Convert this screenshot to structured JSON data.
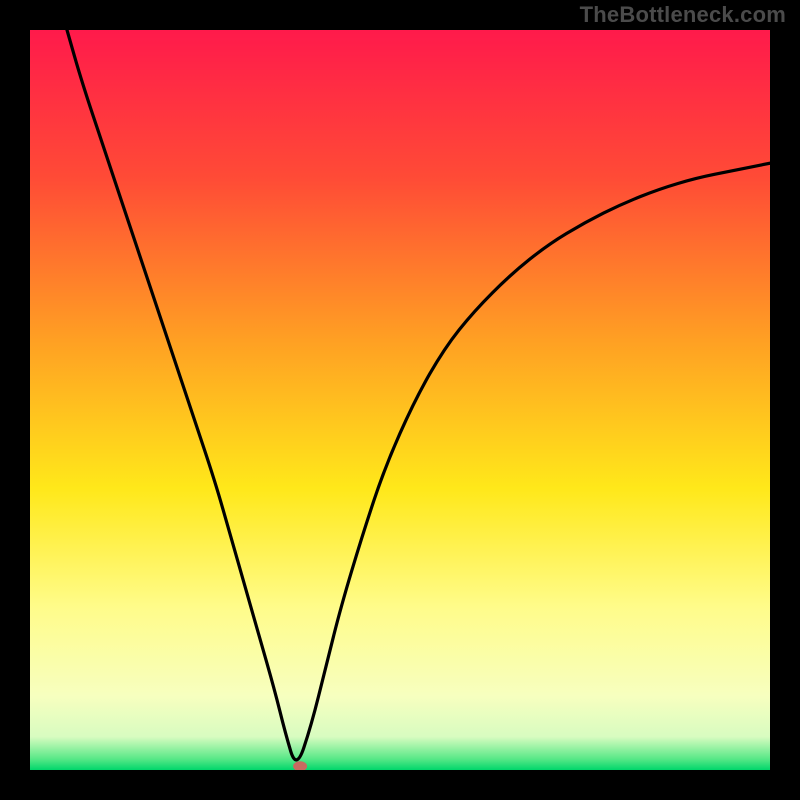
{
  "watermark": "TheBottleneck.com",
  "chart_data": {
    "type": "line",
    "title": "",
    "xlabel": "",
    "ylabel": "",
    "xlim": [
      0,
      100
    ],
    "ylim": [
      0,
      100
    ],
    "grid": false,
    "legend": false,
    "gradient_stops": [
      {
        "offset": 0.0,
        "color": "#ff1a4b"
      },
      {
        "offset": 0.2,
        "color": "#ff4b36"
      },
      {
        "offset": 0.42,
        "color": "#ffa023"
      },
      {
        "offset": 0.62,
        "color": "#ffe81a"
      },
      {
        "offset": 0.78,
        "color": "#fffc8a"
      },
      {
        "offset": 0.9,
        "color": "#f7ffbf"
      },
      {
        "offset": 0.955,
        "color": "#d8fcc0"
      },
      {
        "offset": 0.985,
        "color": "#58e887"
      },
      {
        "offset": 1.0,
        "color": "#00d66b"
      }
    ],
    "series": [
      {
        "name": "bottleneck-curve",
        "x": [
          5,
          7,
          10,
          13,
          16,
          19,
          22,
          25,
          27,
          29,
          31,
          33,
          34.5,
          36,
          38,
          40,
          42,
          45,
          48,
          52,
          56,
          60,
          65,
          70,
          75,
          80,
          85,
          90,
          95,
          100
        ],
        "y": [
          100,
          93,
          84,
          75,
          66,
          57,
          48,
          39,
          32,
          25,
          18,
          11,
          5,
          0,
          6,
          14,
          22,
          32,
          41,
          50,
          57,
          62,
          67,
          71,
          74,
          76.5,
          78.5,
          80,
          81,
          82
        ]
      }
    ],
    "marker": {
      "x": 36.5,
      "y": 0.5,
      "color": "#c76a60"
    }
  }
}
